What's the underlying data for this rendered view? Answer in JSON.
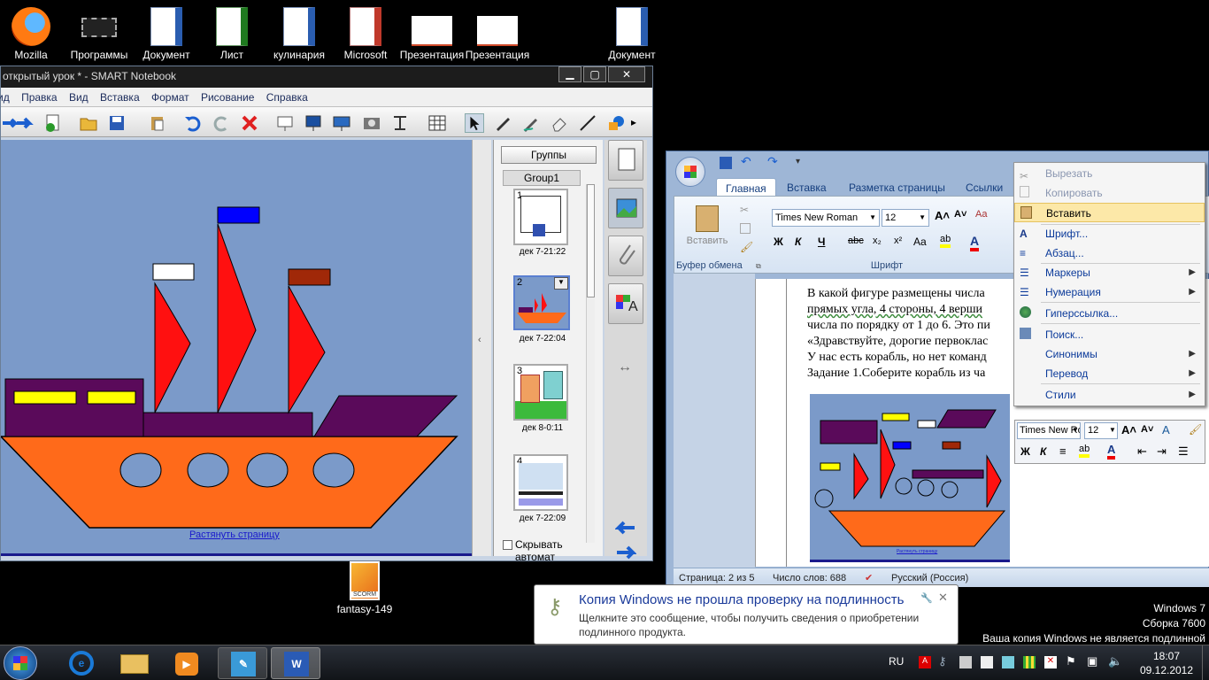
{
  "desktop_icons": [
    {
      "label": "Mozilla",
      "icon": "firefox-icon"
    },
    {
      "label": "Программы",
      "icon": "chip-icon"
    },
    {
      "label": "Документ",
      "icon": "word-doc-icon"
    },
    {
      "label": "Лист",
      "icon": "excel-sheet-icon"
    },
    {
      "label": "кулинария",
      "icon": "word-doc-icon"
    },
    {
      "label": "Microsoft",
      "icon": "powerpoint-icon"
    },
    {
      "label": "Презентация",
      "icon": "presentation-icon"
    },
    {
      "label": "Презентация",
      "icon": "presentation-icon"
    },
    {
      "label": "Документ",
      "icon": "word-doc-icon"
    },
    {
      "label": "fantasy-149",
      "icon": "scorm-package-icon"
    }
  ],
  "scorm_caption": "SCORM",
  "notebook": {
    "title": "открытый урок * - SMART Notebook",
    "menu": [
      "ид",
      "Правка",
      "Вид",
      "Вставка",
      "Формат",
      "Рисование",
      "Справка"
    ],
    "stretch_link": "Растянуть страницу",
    "groups_button": "Группы",
    "group_label": "Group1",
    "pages": [
      {
        "num": "1",
        "time": "дек 7-21:22"
      },
      {
        "num": "2",
        "time": "дек 7-22:04"
      },
      {
        "num": "3",
        "time": "дек 8-0:11"
      },
      {
        "num": "4",
        "time": "дек 7-22:09"
      }
    ],
    "auto_hide": "Скрывать автомат"
  },
  "word": {
    "tabs": [
      "Главная",
      "Вставка",
      "Разметка страницы",
      "Ссылки"
    ],
    "paste_label": "Вставить",
    "font_name": "Times New Roman",
    "font_size": "12",
    "group_clipboard": "Буфер обмена",
    "group_font": "Шрифт",
    "doc_lines": [
      "В какой фигуре размещены числа",
      "прямых угла, 4 стороны, 4 верши",
      "числа по порядку от 1 до 6. Это пи",
      "«Здравствуйте, дорогие первоклас",
      "У нас есть корабль, но нет команд",
      "Задание 1.Соберите  корабль из ча"
    ],
    "embedded_link": "Растянуть страницу",
    "status": {
      "page": "Страница: 2 из 5",
      "words": "Число слов: 688",
      "lang": "Русский (Россия)"
    }
  },
  "context_menu": {
    "items": [
      {
        "label": "Вырезать",
        "disabled": true,
        "icon": "scissors-icon"
      },
      {
        "label": "Копировать",
        "disabled": true,
        "icon": "copy-icon"
      },
      {
        "label": "Вставить",
        "highlight": true,
        "icon": "paste-icon"
      },
      {
        "label": "Шрифт...",
        "icon": "font-icon"
      },
      {
        "label": "Абзац...",
        "icon": "paragraph-icon"
      },
      {
        "label": "Маркеры",
        "submenu": true,
        "icon": "bullets-icon"
      },
      {
        "label": "Нумерация",
        "submenu": true,
        "icon": "numbering-icon"
      },
      {
        "label": "Гиперссылка...",
        "icon": "hyperlink-icon"
      },
      {
        "label": "Поиск...",
        "icon": "research-icon"
      },
      {
        "label": "Синонимы",
        "submenu": true
      },
      {
        "label": "Перевод",
        "submenu": true
      },
      {
        "label": "Стили",
        "submenu": true
      }
    ]
  },
  "mini_toolbar": {
    "font": "Times New Ron",
    "size": "12"
  },
  "balloon": {
    "title": "Копия Windows не прошла проверку на подлинность",
    "text1": "Щелкните это сообщение, чтобы получить сведения о приобретении",
    "text2": "подлинного продукта."
  },
  "watermark": {
    "line1": "Windows 7",
    "line2": "Сборка 7600",
    "line3": "Ваша копия Windows не является подлинной"
  },
  "taskbar": {
    "lang": "RU",
    "time": "18:07",
    "date": "09.12.2012"
  },
  "colors": {
    "ship_hull": "#ff6a1a",
    "ship_cabin": "#5a0a5a",
    "sail": "#ff1010",
    "canvas_bg": "#7b9ac9",
    "flag_blue": "#0000ff",
    "flag_brown": "#a02808"
  }
}
